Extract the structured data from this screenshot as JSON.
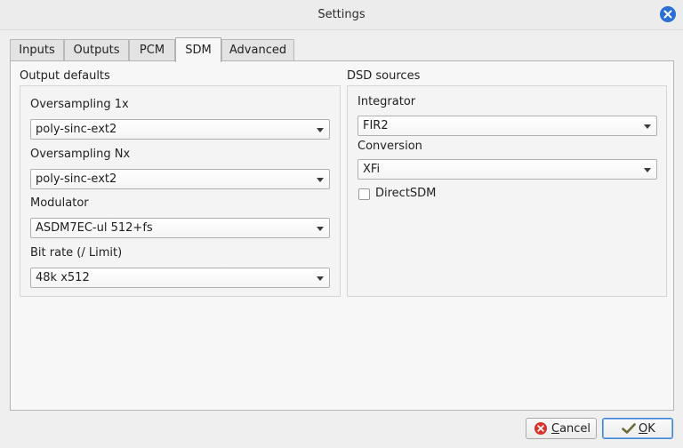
{
  "window": {
    "title": "Settings"
  },
  "tabs": [
    {
      "label": "Inputs"
    },
    {
      "label": "Outputs"
    },
    {
      "label": "PCM"
    },
    {
      "label": "SDM",
      "active": true
    },
    {
      "label": "Advanced"
    }
  ],
  "output_defaults": {
    "group_label": "Output defaults",
    "oversampling_1x": {
      "label": "Oversampling 1x",
      "value": "poly-sinc-ext2"
    },
    "oversampling_nx": {
      "label": "Oversampling Nx",
      "value": "poly-sinc-ext2"
    },
    "modulator": {
      "label": "Modulator",
      "value": "ASDM7EC-ul 512+fs"
    },
    "bit_rate": {
      "label": "Bit rate (/ Limit)",
      "value": "48k x512"
    }
  },
  "dsd_sources": {
    "group_label": "DSD sources",
    "integrator": {
      "label": "Integrator",
      "value": "FIR2"
    },
    "conversion": {
      "label": "Conversion",
      "value": "XFi"
    },
    "direct_sdm": {
      "label": "DirectSDM",
      "checked": false
    }
  },
  "buttons": {
    "cancel_mnemonic": "C",
    "cancel_rest": "ancel",
    "ok_mnemonic": "O",
    "ok_rest": "K"
  },
  "colors": {
    "accent": "#2a6fd1",
    "cancel_icon": "#d9342b",
    "ok_icon": "#6b6b3a"
  },
  "icons": {
    "close": "close-icon",
    "cancel": "cancel-icon",
    "ok": "ok-icon"
  }
}
